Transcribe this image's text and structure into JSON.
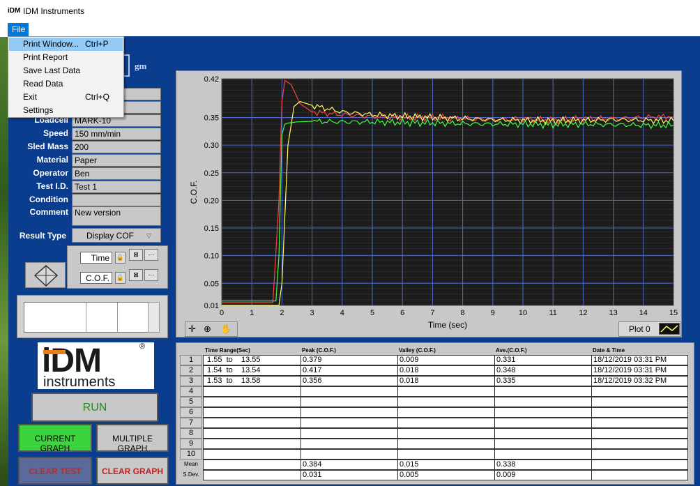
{
  "window": {
    "logo_text": "iDM",
    "title": "IDM Instruments"
  },
  "menubar": {
    "file_label": "File"
  },
  "file_menu": {
    "items": [
      {
        "label": "Print Window...",
        "shortcut": "Ctrl+P"
      },
      {
        "label": "Print Report",
        "shortcut": ""
      },
      {
        "label": "Save Last Data",
        "shortcut": ""
      },
      {
        "label": "Read Data",
        "shortcut": ""
      },
      {
        "label": "Exit",
        "shortcut": "Ctrl+Q"
      },
      {
        "label": "Settings",
        "shortcut": ""
      }
    ]
  },
  "load": {
    "unit": "gm"
  },
  "fields": [
    {
      "label": "Loadcell",
      "value": "MARK-10"
    },
    {
      "label": "Speed",
      "value": "150 mm/min"
    },
    {
      "label": "Sled Mass",
      "value": "200"
    },
    {
      "label": "Material",
      "value": "Paper"
    },
    {
      "label": "Operator",
      "value": "Ben"
    },
    {
      "label": "Test I.D.",
      "value": "Test 1"
    },
    {
      "label": "Condition",
      "value": ""
    },
    {
      "label": "Comment",
      "value": "New version"
    }
  ],
  "result_type": {
    "label": "Result Type",
    "value": "Display COF"
  },
  "axis_controls": {
    "x_name": "Time",
    "y_name": "C.O.F."
  },
  "logo": {
    "main": "iDM",
    "sub": "instruments",
    "reg": "®"
  },
  "buttons": {
    "run": "RUN",
    "current_graph": "CURRENT GRAPH",
    "multiple_graph": "MULTIPLE GRAPH",
    "clear_test": "CLEAR TEST",
    "clear_graph": "CLEAR GRAPH"
  },
  "plot_legend": {
    "label": "Plot 0"
  },
  "colors": {
    "app_bg": "#0b3d8f",
    "plot_bg": "#1c1c1c",
    "series_red": "#ff4040",
    "series_yellow": "#ffff60",
    "series_green": "#40ff40"
  },
  "chart_data": {
    "type": "line",
    "xlabel": "Time (sec)",
    "ylabel": "C.O.F.",
    "xlim": [
      0,
      15
    ],
    "ylim": [
      0.01,
      0.42
    ],
    "x_ticks": [
      "0",
      "1",
      "2",
      "3",
      "4",
      "5",
      "6",
      "7",
      "8",
      "9",
      "10",
      "11",
      "12",
      "13",
      "14",
      "15"
    ],
    "y_ticks": [
      "0.01",
      "0.05",
      "0.10",
      "0.15",
      "0.20",
      "0.25",
      "0.30",
      "0.35",
      "0.42"
    ],
    "grid": true,
    "series": [
      {
        "color": "#ff4040",
        "x": [
          0,
          1.7,
          1.9,
          2.0,
          2.1,
          2.3,
          2.6,
          3,
          4,
          5,
          6,
          7,
          8,
          9,
          10,
          11,
          12,
          13,
          14,
          15
        ],
        "y": [
          0.015,
          0.015,
          0.2,
          0.38,
          0.417,
          0.41,
          0.375,
          0.36,
          0.355,
          0.352,
          0.35,
          0.35,
          0.348,
          0.346,
          0.347,
          0.345,
          0.348,
          0.348,
          0.35,
          0.352
        ]
      },
      {
        "color": "#ffff60",
        "x": [
          0,
          1.9,
          2.0,
          2.2,
          2.4,
          2.6,
          3,
          4,
          5,
          6,
          7,
          8,
          9,
          10,
          11,
          12,
          13,
          14,
          15
        ],
        "y": [
          0.01,
          0.01,
          0.05,
          0.3,
          0.37,
          0.379,
          0.372,
          0.36,
          0.355,
          0.352,
          0.35,
          0.348,
          0.346,
          0.345,
          0.344,
          0.345,
          0.346,
          0.345,
          0.344
        ]
      },
      {
        "color": "#40ff40",
        "x": [
          0,
          1.8,
          1.9,
          2.0,
          2.1,
          2.2,
          2.5,
          3,
          4,
          5,
          6,
          7,
          8,
          9,
          10,
          11,
          12,
          13,
          14,
          15
        ],
        "y": [
          0.018,
          0.018,
          0.1,
          0.32,
          0.338,
          0.34,
          0.342,
          0.343,
          0.342,
          0.342,
          0.341,
          0.34,
          0.339,
          0.338,
          0.338,
          0.337,
          0.338,
          0.337,
          0.336,
          0.336
        ]
      }
    ]
  },
  "results_table": {
    "headers": [
      "Time Range(Sec)",
      "Peak (C.O.F.)",
      "Valley (C.O.F.)",
      "Ave.(C.O.F.)",
      "Date & Time"
    ],
    "row_numbers": [
      "1",
      "2",
      "3",
      "4",
      "5",
      "6",
      "7",
      "8",
      "9",
      "10"
    ],
    "rows": [
      [
        " 1.55  to    13.55",
        "0.379",
        "0.009",
        "0.331",
        "18/12/2019 03:31 PM"
      ],
      [
        " 1.54  to    13.54",
        "0.417",
        "0.018",
        "0.348",
        "18/12/2019 03:31 PM"
      ],
      [
        " 1.53  to    13.58",
        "0.356",
        "0.018",
        "0.335",
        "18/12/2019 03:32 PM"
      ],
      [
        "",
        "",
        "",
        "",
        ""
      ],
      [
        "",
        "",
        "",
        "",
        ""
      ],
      [
        "",
        "",
        "",
        "",
        ""
      ],
      [
        "",
        "",
        "",
        "",
        ""
      ],
      [
        "",
        "",
        "",
        "",
        ""
      ],
      [
        "",
        "",
        "",
        "",
        ""
      ],
      [
        "",
        "",
        "",
        "",
        ""
      ]
    ],
    "mean_label": "Mean",
    "sdev_label": "S.Dev.",
    "mean": [
      "",
      "0.384",
      "0.015",
      "0.338",
      ""
    ],
    "sdev": [
      "",
      "0.031",
      "0.005",
      "0.009",
      ""
    ]
  }
}
